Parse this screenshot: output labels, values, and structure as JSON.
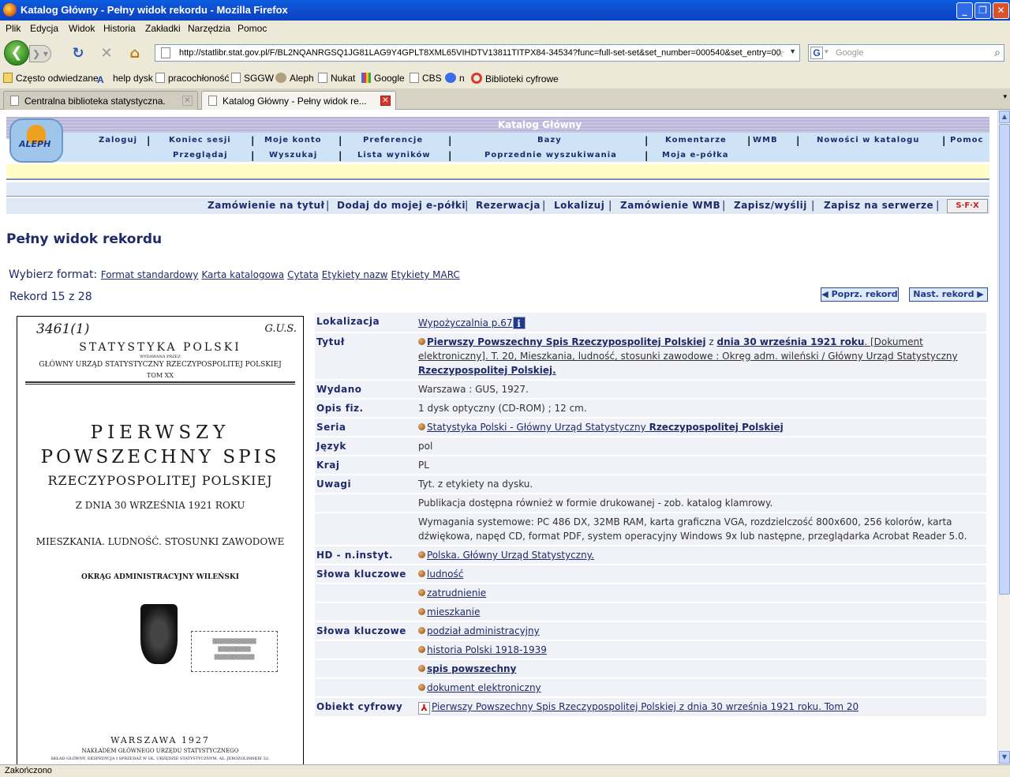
{
  "window": {
    "title": "Katalog Główny - Pełny widok rekordu - Mozilla Firefox"
  },
  "menu": [
    "Plik",
    "Edycja",
    "Widok",
    "Historia",
    "Zakładki",
    "Narzędzia",
    "Pomoc"
  ],
  "nav": {
    "url": "http://statlibr.stat.gov.pl/F/BL2NQANRGSQ1JG81LAG9Y4GPLT8XML65VIHDTV13811TITPX84-34534?func=full-set-set&set_number=000540&set_entry=00",
    "search_placeholder": "Google",
    "search_engine_letter": "G"
  },
  "bookmarks": [
    "Często odwiedzane",
    "help dysk",
    "pracochłoność",
    "SGGW",
    "Aleph",
    "Nukat",
    "Google",
    "CBS",
    "n",
    "Biblioteki cyfrowe"
  ],
  "tabs": [
    {
      "label": "Centralna biblioteka statystyczna."
    },
    {
      "label": "Katalog Główny - Pełny widok re..."
    }
  ],
  "header": {
    "title": "Katalog Główny",
    "logo_text": "ALEPH",
    "row1": [
      "Zaloguj",
      "Koniec sesji",
      "Moje konto",
      "Preferencje",
      "Bazy",
      "Komentarze",
      "WMB",
      "Nowości w katalogu",
      "Pomoc"
    ],
    "row2": [
      "Przeglądaj",
      "Wyszukaj",
      "Lista wyników",
      "Poprzednie wyszukiwania",
      "Moja e-półka"
    ]
  },
  "actions": [
    "Zamówienie na tytuł",
    "Dodaj do mojej e-półki",
    "Rezerwacja",
    "Lokalizuj",
    "Zamówienie WMB",
    "Zapisz/wyślij",
    "Zapisz na serwerze"
  ],
  "sfx_label": "S·F·X",
  "page": {
    "title": "Pełny widok rekordu",
    "format_label": "Wybierz format:",
    "formats": [
      "Format standardowy",
      "Karta katalogowa",
      "Cytata",
      "Etykiety nazw",
      "Etykiety MARC"
    ],
    "record_counter": "Rekord 15 z 28",
    "prev_record": "◀ Poprz. rekord",
    "next_record": "Nast. rekord ▶"
  },
  "cover": {
    "handwritten_left": "3461(1)",
    "handwritten_right": "G.U.S.",
    "series": "STATYSTYKA POLSKI",
    "publisher_small": "WYDAWANA PRZEZ",
    "publisher": "GŁÓWNY URZĄD STATYSTYCZNY RZECZYPOSPOLITEJ POLSKIEJ",
    "volume": "TOM XX",
    "title_1": "PIERWSZY",
    "title_2": "POWSZECHNY SPIS",
    "title_3": "RZECZYPOSPOLITEJ POLSKIEJ",
    "date": "Z DNIA 30 WRZEŚNIA 1921 ROKU",
    "subjects": "MIESZKANIA.  LUDNOŚĆ.  STOSUNKI ZAWODOWE",
    "district": "OKRĄG ADMINISTRACYJNY WILEŃSKI",
    "city_year": "WARSZAWA  1927",
    "imprint": "NAKŁADEM GŁÓWNEGO URZĘDU STATYSTYCZNEGO",
    "distribution": "SKŁAD GŁÓWNY, EKSPEDYCJA I SPRZEDAŻ W GŁ. URZĘDZIE STATYSTYCZNYM, AL. JEROZOLIMSKIE 32."
  },
  "record": {
    "lokalizacja_label": "Lokalizacja",
    "lokalizacja": "Wypożyczalnia p.67",
    "tytul_label": "Tytuł",
    "tytul_link1": "Pierwszy Powszechny Spis Rzeczypospolitej Polskiej",
    "tytul_mid": " z ",
    "tytul_link2": "dnia 30 września 1921 roku",
    "tytul_rest": ". [Dokument elektroniczny]. T. 20, Mieszkania, ludność, stosunki zawodowe : Okręg adm. wileński / Główny Urząd Statystyczny ",
    "tytul_link3": "Rzeczypospolitej Polskiej.",
    "wydano_label": "Wydano",
    "wydano": "Warszawa : GUS, 1927.",
    "opis_label": "Opis fiz.",
    "opis": "1 dysk optyczny (CD-ROM) ; 12 cm.",
    "seria_label": "Seria",
    "seria_link1": "Statystyka Polski - Główny Urząd Statystyczny ",
    "seria_link2": "Rzeczypospolitej Polskiej",
    "jezyk_label": "Język",
    "jezyk": "pol",
    "kraj_label": "Kraj",
    "kraj": "PL",
    "uwagi_label": "Uwagi",
    "uwagi": [
      "Tyt. z etykiety na dysku.",
      "Publikacja dostępna również w formie drukowanej - zob. katalog klamrowy.",
      "Wymagania systemowe: PC 486 DX, 32MB RAM, karta graficzna VGA, rozdzielczość 800x600, 256 kolorów, karta dźwiękowa, napęd CD, format PDF, system operacyjny Windows 9x lub następne, przeglądarka Acrobat Reader 5.0."
    ],
    "hd_label": "HD - n.instyt.",
    "hd": "Polska. Główny Urząd Statystyczny.",
    "slowa1_label": "Słowa kluczowe",
    "slowa1": [
      "ludność",
      "zatrudnienie",
      "mieszkanie"
    ],
    "slowa2_label": "Słowa kluczowe",
    "slowa2": [
      "podział administracyjny",
      "historia Polski 1918-1939",
      "spis powszechny",
      "dokument elektroniczny"
    ],
    "obiekt_label": "Obiekt cyfrowy",
    "obiekt": "Pierwszy Powszechny Spis Rzeczypospolitej Polskiej z dnia 30 września 1921 roku. Tom 20"
  },
  "status": "Zakończono"
}
